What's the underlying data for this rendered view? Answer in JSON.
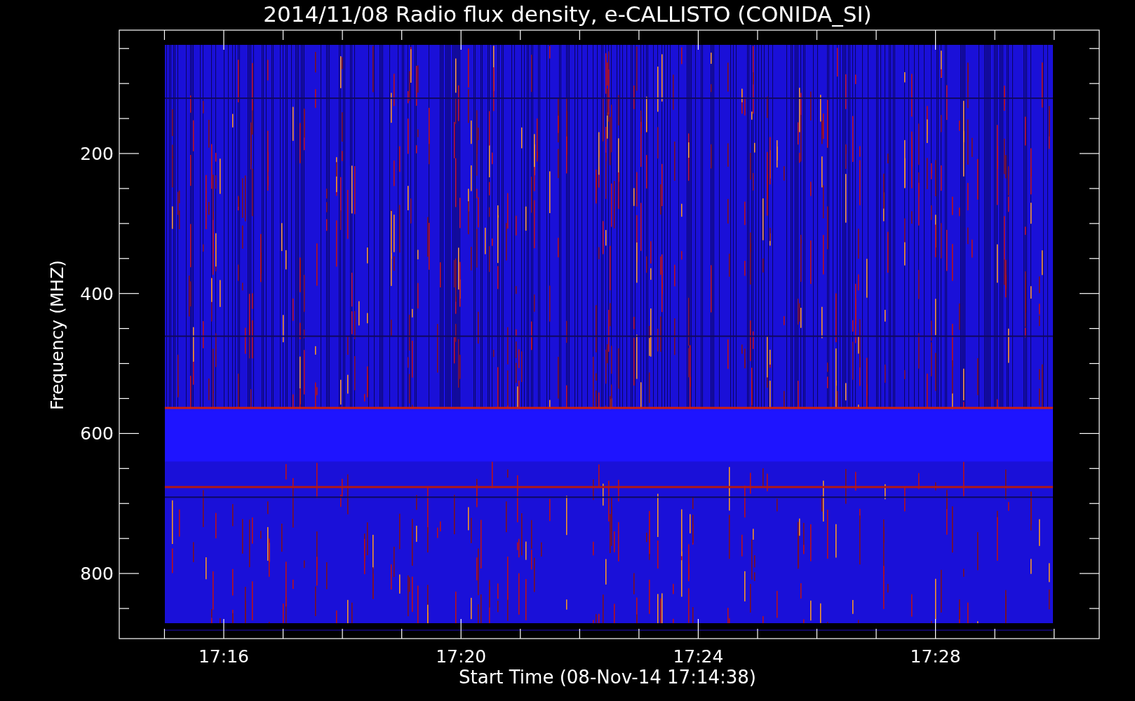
{
  "title": "2014/11/08  Radio flux density, e-CALLISTO (CONIDA_SI)",
  "ylabel": "Frequency (MHZ)",
  "xlabel": "Start Time (08-Nov-14 17:14:38)",
  "yticks": [
    "200",
    "400",
    "600",
    "800"
  ],
  "xticks": [
    "17:16",
    "17:20",
    "17:24",
    "17:28"
  ]
}
